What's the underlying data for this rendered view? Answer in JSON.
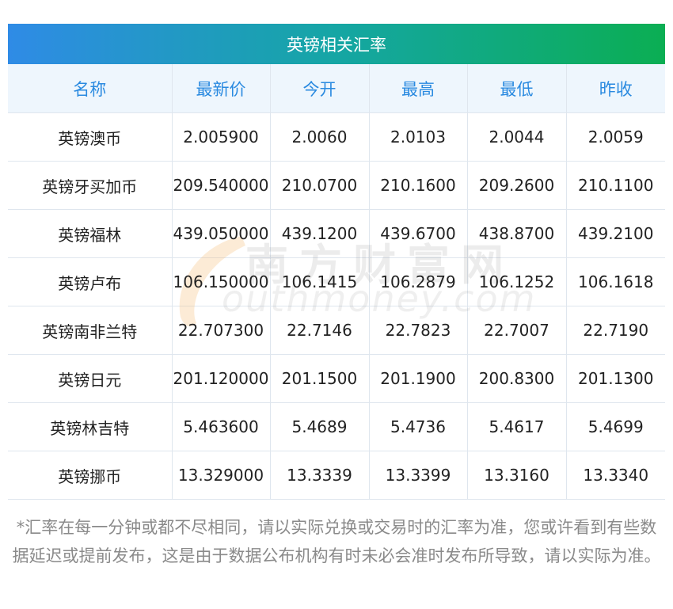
{
  "title": "英镑相关汇率",
  "columns": [
    "名称",
    "最新价",
    "今开",
    "最高",
    "最低",
    "昨收"
  ],
  "rows": [
    [
      "英镑澳币",
      "2.005900",
      "2.0060",
      "2.0103",
      "2.0044",
      "2.0059"
    ],
    [
      "英镑牙买加币",
      "209.540000",
      "210.0700",
      "210.1600",
      "209.2600",
      "210.1100"
    ],
    [
      "英镑福林",
      "439.050000",
      "439.1200",
      "439.6700",
      "438.8700",
      "439.2100"
    ],
    [
      "英镑卢布",
      "106.150000",
      "106.1415",
      "106.2879",
      "106.1252",
      "106.1618"
    ],
    [
      "英镑南非兰特",
      "22.707300",
      "22.7146",
      "22.7823",
      "22.7007",
      "22.7190"
    ],
    [
      "英镑日元",
      "201.120000",
      "201.1500",
      "201.1900",
      "200.8300",
      "201.1300"
    ],
    [
      "英镑林吉特",
      "5.463600",
      "5.4689",
      "5.4736",
      "5.4617",
      "5.4699"
    ],
    [
      "英镑挪币",
      "13.329000",
      "13.3339",
      "13.3399",
      "13.3160",
      "13.3340"
    ]
  ],
  "watermark": {
    "cn": "南方财富网",
    "en": "outhmoney.com"
  },
  "footnote": "*汇率在每一分钟或都不尽相同，请以实际兑换或交易时的汇率为准，您或许看到有些数据延迟或提前发布，这是由于数据公布机构有时未必会准时发布所导致，请以实际为准。",
  "colors": {
    "header_text": "#2a8ae0",
    "header_bg": "#eef6fd",
    "title_gradient_start": "#2f8be6",
    "title_gradient_end": "#0bae53"
  }
}
